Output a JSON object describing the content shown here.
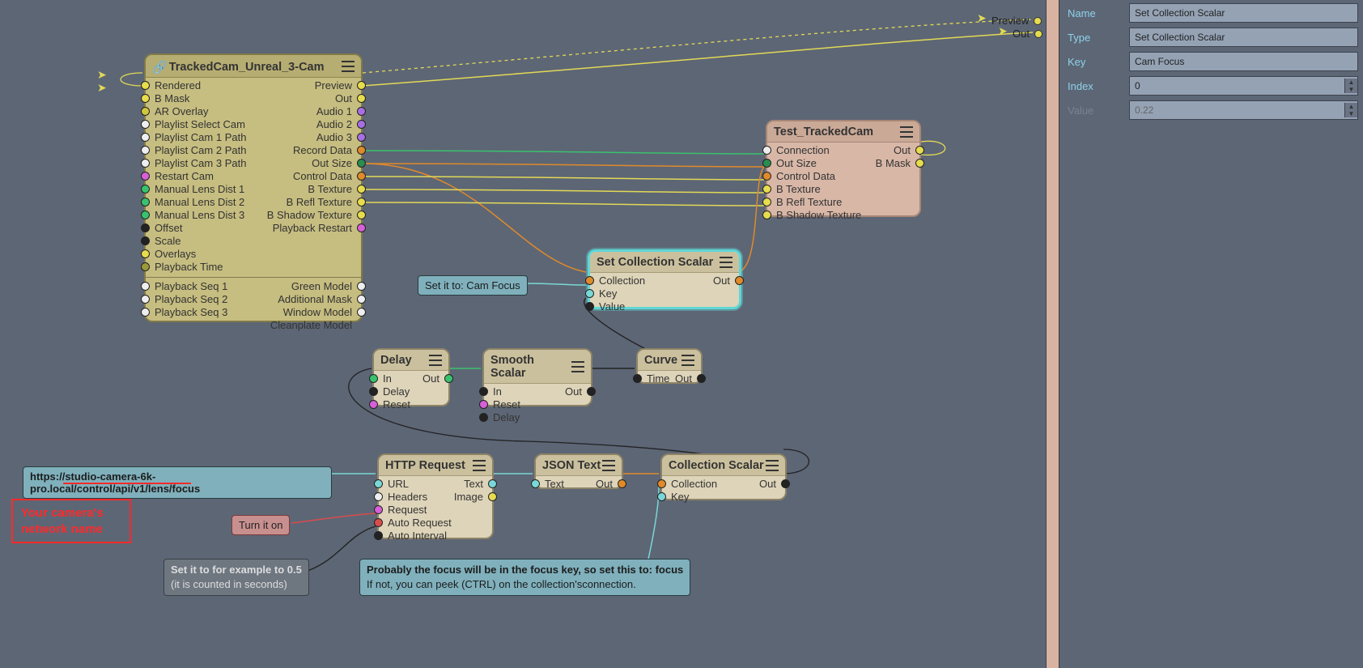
{
  "properties": {
    "name_label": "Name",
    "name_value": "Set Collection Scalar",
    "type_label": "Type",
    "type_value": "Set Collection Scalar",
    "key_label": "Key",
    "key_value": "Cam Focus",
    "index_label": "Index",
    "index_value": "0",
    "value_label": "Value",
    "value_value": "0.22"
  },
  "bar_ports": {
    "preview": "Preview",
    "out": "Out"
  },
  "nodes": {
    "trackedcam": {
      "title": "TrackedCam_Unreal_3-Cam",
      "left": [
        "Rendered",
        "B Mask",
        "AR Overlay",
        "Playlist Select Cam",
        "Playlist Cam 1 Path",
        "Playlist Cam 2 Path",
        "Playlist Cam 3 Path",
        "Restart Cam",
        "Manual Lens Dist 1",
        "Manual Lens Dist 2",
        "Manual Lens Dist 3",
        "Offset",
        "Scale",
        "Overlays",
        "Playback Time"
      ],
      "left2": [
        "Playback Seq 1",
        "Playback Seq 2",
        "Playback Seq 3"
      ],
      "right": [
        "Preview",
        "Out",
        "Audio 1",
        "Audio 2",
        "Audio 3",
        "Record Data",
        "Out Size",
        "Control Data",
        "B Texture",
        "B Refl Texture",
        "B Shadow Texture",
        "Playback Restart"
      ],
      "right2": [
        "Green Model",
        "Additional Mask",
        "Window Model",
        "Cleanplate Model"
      ]
    },
    "test": {
      "title": "Test_TrackedCam",
      "left": [
        "Connection",
        "Out Size",
        "Control Data",
        "B Texture",
        "B Refl Texture",
        "B Shadow Texture"
      ],
      "right": [
        "Out",
        "B Mask"
      ]
    },
    "setcol": {
      "title": "Set Collection Scalar",
      "left": [
        "Collection",
        "Key",
        "Value"
      ],
      "right": [
        "Out"
      ]
    },
    "delay": {
      "title": "Delay",
      "left": [
        "In",
        "Delay",
        "Reset"
      ],
      "right": [
        "Out"
      ]
    },
    "smooth": {
      "title": "Smooth Scalar",
      "left": [
        "In",
        "Reset",
        "Delay"
      ],
      "right": [
        "Out"
      ]
    },
    "curve": {
      "title": "Curve",
      "left": [
        "Time"
      ],
      "right": [
        "Out"
      ]
    },
    "http": {
      "title": "HTTP Request",
      "left": [
        "URL",
        "Headers",
        "Request",
        "Auto Request",
        "Auto Interval"
      ],
      "right": [
        "Text",
        "Image"
      ]
    },
    "json": {
      "title": "JSON Text",
      "left": [
        "Text"
      ],
      "right": [
        "Out"
      ]
    },
    "colscalar": {
      "title": "Collection Scalar",
      "left": [
        "Collection",
        "Key"
      ],
      "right": [
        "Out"
      ]
    }
  },
  "annotations": {
    "camfocus": "Set it to: Cam Focus",
    "url": "https://studio-camera-6k-pro.local/control/api/v1/lens/focus",
    "turnon": "Turn it on",
    "interval_l1": "Set it to for example to 0.5",
    "interval_l2": "(it is counted in seconds)",
    "focus_l1": "Probably the focus will be in the focus key, so set this to: focus",
    "focus_l2": "If not, you can peek (CTRL) on the collection'sconnection.",
    "networkname_l1": "Your camera's",
    "networkname_l2": "network name"
  }
}
